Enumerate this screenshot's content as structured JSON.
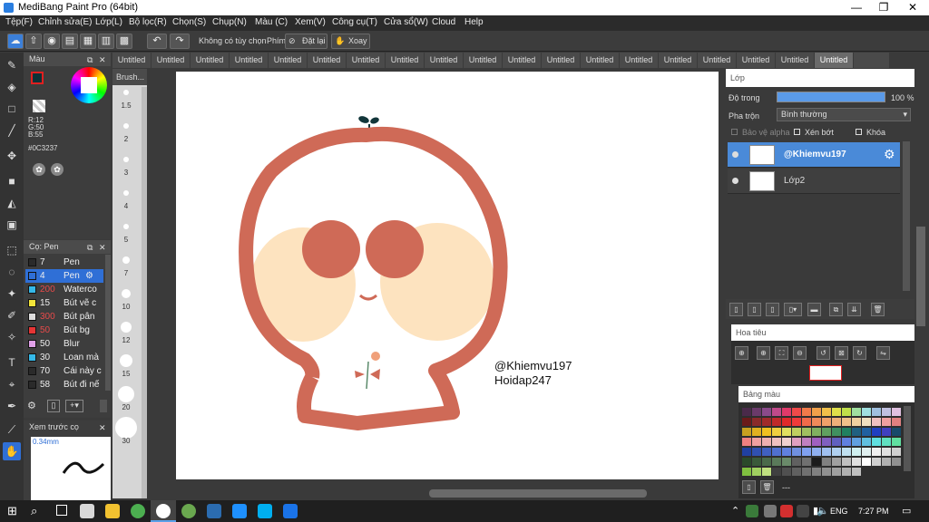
{
  "window": {
    "title": "MediBang Paint Pro (64bit)",
    "minimize": "—",
    "restore": "❐",
    "close": "✕"
  },
  "menu": [
    "Tệp(F)",
    "Chỉnh sửa(E)",
    "Lớp(L)",
    "Bộ lọc(R)",
    "Chọn(S)",
    "Chụp(N)",
    "Màu (C)",
    "Xem(V)",
    "Công cụ(T)",
    "Cửa sổ(W)",
    "Cloud",
    "Help"
  ],
  "toolbar": {
    "option": "Không có tùy chọn",
    "key_label": "Phím",
    "reset": "Đặt lại",
    "rotate": "Xoay"
  },
  "tabs": {
    "label": "Untitled",
    "count": 19,
    "active_index": 18
  },
  "color_panel": {
    "title": "Màu",
    "r": "R:12",
    "g": "G:50",
    "b": "B:55",
    "hex": "#0C3237",
    "fg": "#0c3237",
    "bg": "#ffffff"
  },
  "brush_panel": {
    "title": "Cọ: Pen",
    "items": [
      {
        "size": "7",
        "name": "Pen",
        "color": "#2a2a2a"
      },
      {
        "size": "4",
        "name": "Pen",
        "color": "#2f6fd6",
        "selected": true
      },
      {
        "size": "200",
        "name": "Waterco",
        "color": "#35b8e8",
        "red": true
      },
      {
        "size": "15",
        "name": "Bút vẽ c",
        "color": "#f2e43a"
      },
      {
        "size": "300",
        "name": "Bút pân",
        "color": "#dcdcdc",
        "red": true
      },
      {
        "size": "50",
        "name": "Bút bg",
        "color": "#e63535",
        "red": true
      },
      {
        "size": "50",
        "name": "Blur",
        "color": "#e0a0e8"
      },
      {
        "size": "30",
        "name": "Loan mà",
        "color": "#35b8e8"
      },
      {
        "size": "70",
        "name": "Cái này c",
        "color": "#2a2a2a"
      },
      {
        "size": "58",
        "name": "Bút đi nế",
        "color": "#2a2a2a"
      }
    ]
  },
  "brush_sizes": {
    "title": "Brush...",
    "labels": [
      "1.5",
      "2",
      "3",
      "4",
      "5",
      "7",
      "10",
      "12",
      "15",
      "20",
      "30"
    ]
  },
  "preview": {
    "title": "Xem trước cọ",
    "size": "0.34mm"
  },
  "layer_panel": {
    "title": "Lớp",
    "opacity_label": "Độ trong",
    "opacity_value": "100 %",
    "blend_label": "Pha trộn",
    "blend_value": "Bình thường",
    "protect_alpha": "Bảo vệ alpha",
    "clipping": "Xén bớt",
    "lock": "Khóa",
    "layers": [
      {
        "name": "@Khiemvu197",
        "selected": true
      },
      {
        "name": "Lớp2",
        "selected": false
      }
    ]
  },
  "navigator": {
    "title": "Hoa tiêu"
  },
  "palette": {
    "title": "Bảng màu",
    "footer": "---"
  },
  "canvas_text": {
    "line1": "@Khiemvu197",
    "line2": "Hoidap247"
  },
  "taskbar": {
    "lang": "ENG",
    "time": "7:27 PM"
  },
  "colors": {
    "accent": "#2f6fd6",
    "character_outline": "#cf6a57",
    "cheek": "#fde3bf"
  }
}
